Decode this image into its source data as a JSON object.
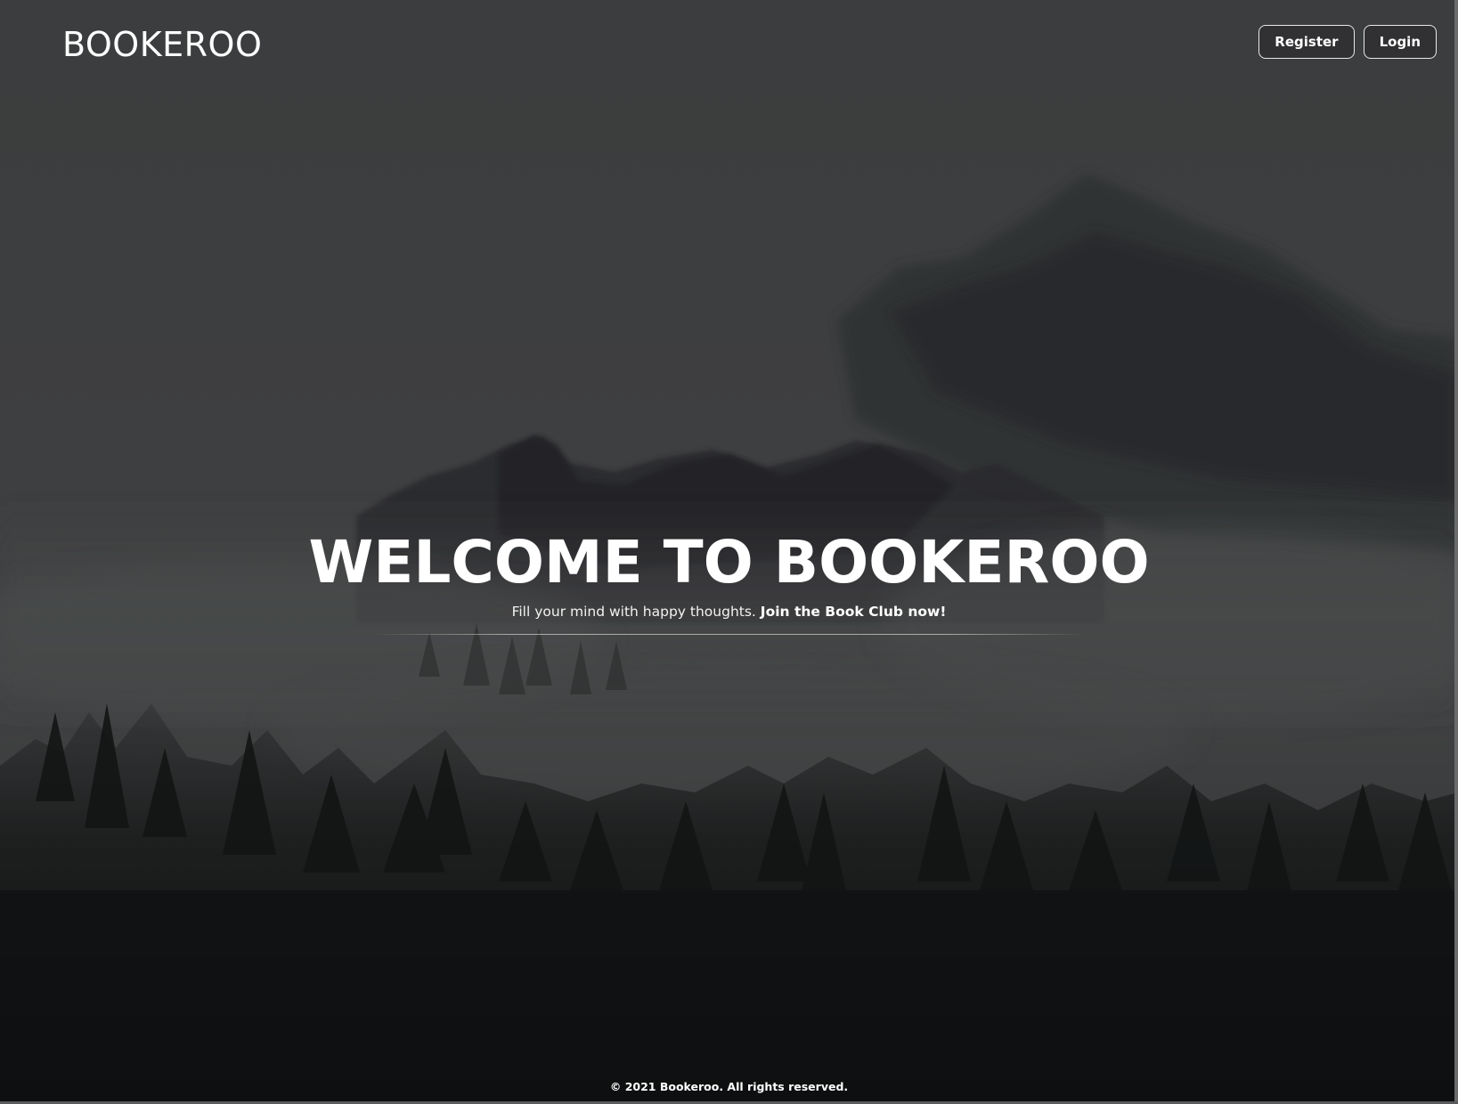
{
  "header": {
    "brand": "BOOKEROO",
    "register_label": "Register",
    "login_label": "Login"
  },
  "hero": {
    "title": "WELCOME TO BOOKEROO",
    "subtitle_plain": "Fill your mind with happy thoughts.",
    "subtitle_bold": "Join the Book Club now!"
  },
  "footer": {
    "copyright": "© 2021 Bookeroo. All rights reserved."
  },
  "colors": {
    "overlay": "#3a3b3c",
    "text": "#ffffff",
    "button_border": "#e8e8e8"
  },
  "background": {
    "icon": "misty-forest-mountain-image"
  }
}
